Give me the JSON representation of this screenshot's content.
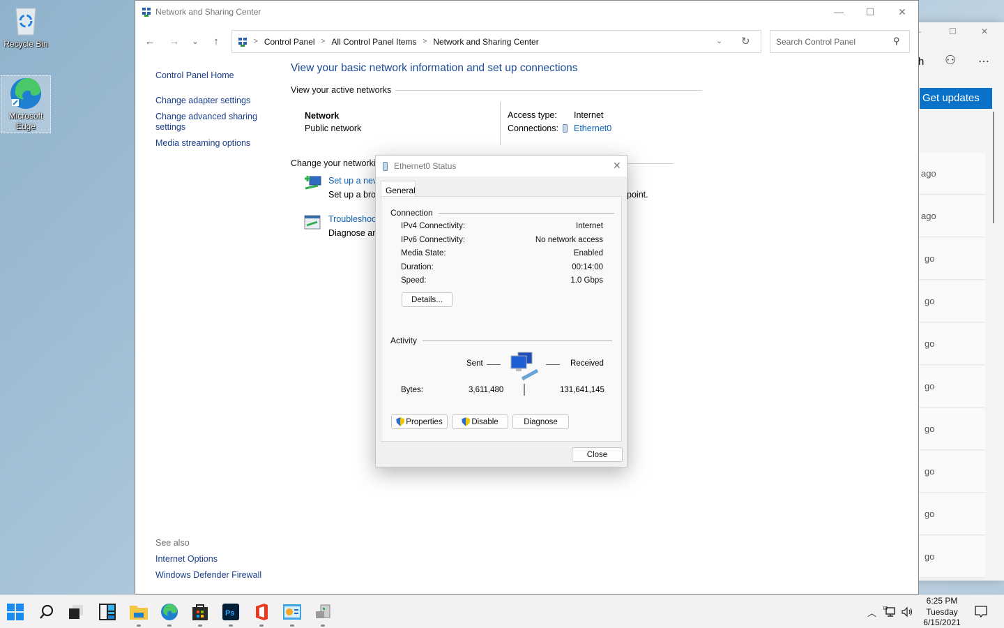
{
  "desktop": {
    "icons": [
      {
        "label": "Recycle Bin",
        "icon": "recycle-bin-icon"
      },
      {
        "label": "Microsoft Edge",
        "icon": "edge-icon",
        "selected": true
      }
    ]
  },
  "background_window": {
    "partial_label": "h",
    "get_updates_label": "Get updates",
    "list_items": [
      "ago",
      "ago",
      "go",
      "go",
      "go",
      "go",
      "go",
      "go",
      "go",
      "go"
    ]
  },
  "window": {
    "title": "Network and Sharing Center",
    "controls": {
      "minimize": "—",
      "maximize": "☐",
      "close": "✕"
    },
    "nav": {
      "back": "←",
      "forward": "→",
      "recent": "⌄",
      "up": "↑"
    },
    "breadcrumb": [
      "Control Panel",
      "All Control Panel Items",
      "Network and Sharing Center"
    ],
    "search_placeholder": "Search Control Panel"
  },
  "sidebar": {
    "items": [
      {
        "label": "Control Panel Home"
      },
      {
        "label": "Change adapter settings"
      },
      {
        "label": "Change advanced sharing settings"
      },
      {
        "label": "Media streaming options"
      }
    ],
    "see_also_heading": "See also",
    "see_also": [
      {
        "label": "Internet Options"
      },
      {
        "label": "Windows Defender Firewall"
      }
    ]
  },
  "main": {
    "heading": "View your basic network information and set up connections",
    "active_networks_label": "View your active networks",
    "network_name": "Network",
    "network_type": "Public network",
    "access_type_label": "Access type:",
    "access_type_value": "Internet",
    "connections_label": "Connections:",
    "connections_value": "Ethernet0",
    "change_settings_label": "Change your networking settings",
    "tasks": [
      {
        "title": "Set up a new connection or network",
        "desc": "Set up a broadband, dial-up, or VPN connection; or set up a router or access point."
      },
      {
        "title": "Troubleshoot problems",
        "desc": "Diagnose and repair network problems, or get troubleshooting information."
      }
    ]
  },
  "dialog": {
    "title": "Ethernet0 Status",
    "tab": "General",
    "connection_heading": "Connection",
    "connection_rows": [
      {
        "label": "IPv4 Connectivity:",
        "value": "Internet"
      },
      {
        "label": "IPv6 Connectivity:",
        "value": "No network access"
      },
      {
        "label": "Media State:",
        "value": "Enabled"
      },
      {
        "label": "Duration:",
        "value": "00:14:00"
      },
      {
        "label": "Speed:",
        "value": "1.0 Gbps"
      }
    ],
    "details_button": "Details...",
    "activity_heading": "Activity",
    "sent_label": "Sent",
    "received_label": "Received",
    "bytes_label": "Bytes:",
    "bytes_sent": "3,611,480",
    "bytes_received": "131,641,145",
    "properties_button": "Properties",
    "disable_button": "Disable",
    "diagnose_button": "Diagnose",
    "close_button": "Close"
  },
  "taskbar": {
    "apps": [
      "start",
      "search",
      "task-view",
      "widgets",
      "file-explorer",
      "edge",
      "store",
      "photoshop",
      "office",
      "control-panel",
      "network-app"
    ],
    "clock_time": "6:25 PM",
    "clock_day": "Tuesday",
    "clock_date": "6/15/2021"
  }
}
